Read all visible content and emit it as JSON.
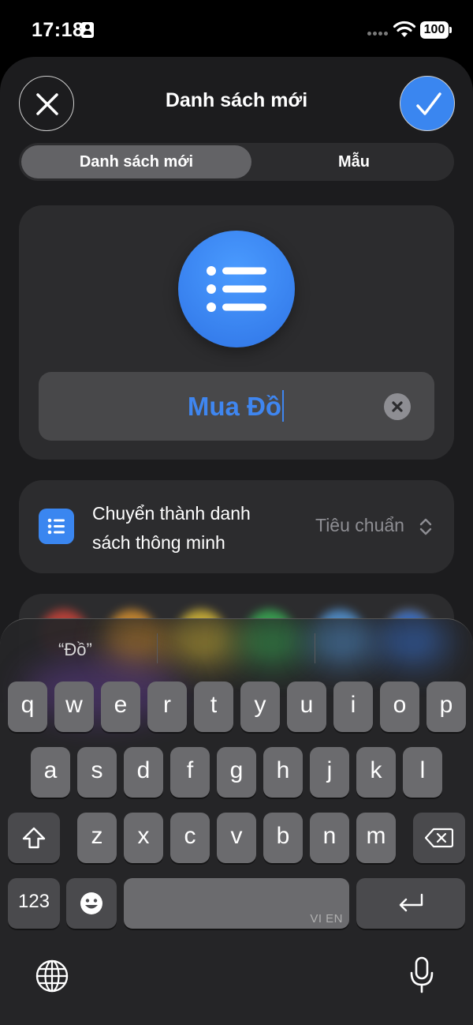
{
  "status_bar": {
    "time": "17:18",
    "battery": "100"
  },
  "header": {
    "title": "Danh sách mới"
  },
  "segmented": {
    "options": [
      "Danh sách mới",
      "Mẫu"
    ],
    "selected": "Danh sách mới"
  },
  "list_name": {
    "value": "Mua Đồ"
  },
  "smart_list": {
    "label": "Chuyển thành danh sách thông minh",
    "label_line1": "Chuyển thành danh",
    "label_line2": "sách thông minh",
    "value": "Tiêu chuẩn"
  },
  "colors": [
    "#e5483c",
    "#f0a030",
    "#f2d03a",
    "#3cc05a",
    "#5aa6f0",
    "#3a7ff0"
  ],
  "keyboard": {
    "suggestion": "“Đồ”",
    "row1": [
      "q",
      "w",
      "e",
      "r",
      "t",
      "y",
      "u",
      "i",
      "o",
      "p"
    ],
    "row2": [
      "a",
      "s",
      "d",
      "f",
      "g",
      "h",
      "j",
      "k",
      "l"
    ],
    "row3": [
      "z",
      "x",
      "c",
      "v",
      "b",
      "n",
      "m"
    ],
    "numbers_key": "123",
    "space_label": "VI EN"
  },
  "accent_color": "#3a86f0"
}
